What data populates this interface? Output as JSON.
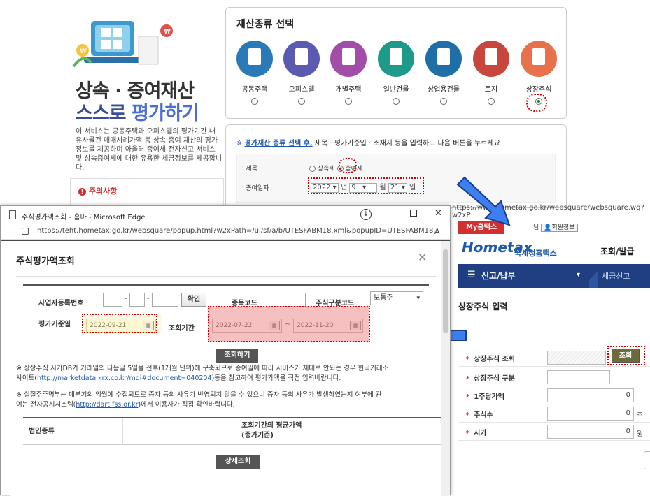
{
  "left_promo": {
    "title_line1": "상속 · 증여재산",
    "title_line2_a": "스스로",
    "title_line2_b": "평가하기",
    "description": "이 서비스는 공동주택과 오피스텔의 평가기간 내 유사물건 매매사례가액 등 상속·증여 재산의 평가정보를 제공하며 아울러 증여세 전자신고 서비스 및 상속증여세에 대한 유용한 세금정보를 제공합니다.",
    "notice_title": "주의사항"
  },
  "property_panel": {
    "title": "재산종류 선택",
    "items": [
      {
        "label": "공동주택",
        "color": "#2a7ab8",
        "selected": false
      },
      {
        "label": "오피스텔",
        "color": "#5a5ab0",
        "selected": false
      },
      {
        "label": "개별주택",
        "color": "#a24ea8",
        "selected": false
      },
      {
        "label": "일반건물",
        "color": "#1d9a8a",
        "selected": false
      },
      {
        "label": "상업용건물",
        "color": "#1e6fa8",
        "selected": false
      },
      {
        "label": "토지",
        "color": "#c9463d",
        "selected": false
      },
      {
        "label": "상장주식",
        "color": "#e8704a",
        "selected": true
      }
    ]
  },
  "form_panel": {
    "note_prefix": "※",
    "note_link": "평가재산 종류 선택 후,",
    "note_rest": " 세목 · 평가기준일 · 소재지 등을 입력하고 다음 버튼을 누르세요",
    "tax_label": "세목",
    "tax_opt1": "상속세",
    "tax_opt2": "증여세",
    "date_label": "증여일자",
    "year": "2022",
    "year_unit": "년",
    "month": "9",
    "month_unit": "월",
    "day": "21",
    "day_unit": "일"
  },
  "edge_window": {
    "title": "주식평가액조회 - 홈마 - Microsoft Edge",
    "url": "https://teht.hometax.go.kr/websquare/popup.html?w2xPath=/ui/sf/a/b/UTESFABM18.xml&popupID=UTESFABM18...",
    "dialog_title": "주식평가액조회",
    "close": "✕",
    "biz_no_label": "사업자등록번호",
    "confirm_btn": "확인",
    "stock_code_label": "종목코드",
    "stock_type_label": "주식구분코드",
    "stock_type_value": "보통주",
    "eval_date_label": "평가기준일",
    "eval_date": "2022-09-21",
    "period_label": "조회기간",
    "period_from": "2022-07-22",
    "period_tilde": "~",
    "period_to": "2022-11-20",
    "search_btn": "조회하기",
    "info1_line1": "※ 상장주식 시가DB가 거래일의 다음달 5일을 전후(1개월 단위)해 구축되므로 증여일에 따라 서비스가 제대로 안되는 경우 한국거래소",
    "info1_line2a": "사이트(",
    "info1_link": "http://marketdata.krx.co.kr/mdi#document=040204",
    "info1_line2b": ")등을 참고하여 평가가액을 직접 입력바랍니다.",
    "info2_line1": "※ 실질주주명부는 매분기의 익월에 수집되므로 증자 등의 사유가 반영되지 않을 수 있으니 증자 등의 사유가 발생하였는지 여부에 관",
    "info2_line2a": "여는 전자공시시스템(",
    "info2_link": "http://dart.fss.or.kr",
    "info2_line2b": ")에서 이용자가 직접 확인바랍니다.",
    "col_corp": "법인종류",
    "col_avg_line1": "조회기간의 평균가액",
    "col_avg_line2": "(종가기준)",
    "detail_btn": "상세조회"
  },
  "hometax": {
    "url": "https://www.hometax.go.kr/websquare/websquare.wq?w2xP",
    "my_home": "My홈택스",
    "member_info": "회원정보",
    "logo": "Hometax",
    "logo_sub": "국세청홈택스",
    "query_issue": "조회/발급",
    "nav_menu": "신고/납부",
    "nav_sub": "세금신고",
    "section_title": "상장주식 입력",
    "rows": [
      {
        "label": "상장주식 조회",
        "value": ""
      },
      {
        "label": "상장주식 구분",
        "value": ""
      },
      {
        "label": "1주당가액",
        "value": "0"
      },
      {
        "label": "주식수",
        "value": "0",
        "unit": "주"
      },
      {
        "label": "시가",
        "value": "0",
        "unit": "원"
      }
    ],
    "lookup_btn": "조회"
  }
}
